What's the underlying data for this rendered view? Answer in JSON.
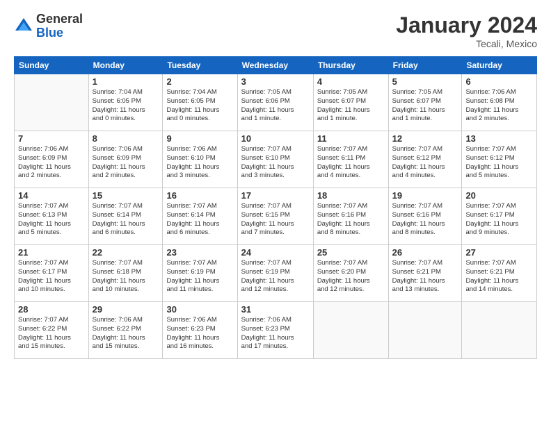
{
  "header": {
    "logo_general": "General",
    "logo_blue": "Blue",
    "month_title": "January 2024",
    "location": "Tecali, Mexico"
  },
  "days_of_week": [
    "Sunday",
    "Monday",
    "Tuesday",
    "Wednesday",
    "Thursday",
    "Friday",
    "Saturday"
  ],
  "weeks": [
    [
      {
        "day": "",
        "info": ""
      },
      {
        "day": "1",
        "info": "Sunrise: 7:04 AM\nSunset: 6:05 PM\nDaylight: 11 hours\nand 0 minutes."
      },
      {
        "day": "2",
        "info": "Sunrise: 7:04 AM\nSunset: 6:05 PM\nDaylight: 11 hours\nand 0 minutes."
      },
      {
        "day": "3",
        "info": "Sunrise: 7:05 AM\nSunset: 6:06 PM\nDaylight: 11 hours\nand 1 minute."
      },
      {
        "day": "4",
        "info": "Sunrise: 7:05 AM\nSunset: 6:07 PM\nDaylight: 11 hours\nand 1 minute."
      },
      {
        "day": "5",
        "info": "Sunrise: 7:05 AM\nSunset: 6:07 PM\nDaylight: 11 hours\nand 1 minute."
      },
      {
        "day": "6",
        "info": "Sunrise: 7:06 AM\nSunset: 6:08 PM\nDaylight: 11 hours\nand 2 minutes."
      }
    ],
    [
      {
        "day": "7",
        "info": "Sunrise: 7:06 AM\nSunset: 6:09 PM\nDaylight: 11 hours\nand 2 minutes."
      },
      {
        "day": "8",
        "info": "Sunrise: 7:06 AM\nSunset: 6:09 PM\nDaylight: 11 hours\nand 2 minutes."
      },
      {
        "day": "9",
        "info": "Sunrise: 7:06 AM\nSunset: 6:10 PM\nDaylight: 11 hours\nand 3 minutes."
      },
      {
        "day": "10",
        "info": "Sunrise: 7:07 AM\nSunset: 6:10 PM\nDaylight: 11 hours\nand 3 minutes."
      },
      {
        "day": "11",
        "info": "Sunrise: 7:07 AM\nSunset: 6:11 PM\nDaylight: 11 hours\nand 4 minutes."
      },
      {
        "day": "12",
        "info": "Sunrise: 7:07 AM\nSunset: 6:12 PM\nDaylight: 11 hours\nand 4 minutes."
      },
      {
        "day": "13",
        "info": "Sunrise: 7:07 AM\nSunset: 6:12 PM\nDaylight: 11 hours\nand 5 minutes."
      }
    ],
    [
      {
        "day": "14",
        "info": "Sunrise: 7:07 AM\nSunset: 6:13 PM\nDaylight: 11 hours\nand 5 minutes."
      },
      {
        "day": "15",
        "info": "Sunrise: 7:07 AM\nSunset: 6:14 PM\nDaylight: 11 hours\nand 6 minutes."
      },
      {
        "day": "16",
        "info": "Sunrise: 7:07 AM\nSunset: 6:14 PM\nDaylight: 11 hours\nand 6 minutes."
      },
      {
        "day": "17",
        "info": "Sunrise: 7:07 AM\nSunset: 6:15 PM\nDaylight: 11 hours\nand 7 minutes."
      },
      {
        "day": "18",
        "info": "Sunrise: 7:07 AM\nSunset: 6:16 PM\nDaylight: 11 hours\nand 8 minutes."
      },
      {
        "day": "19",
        "info": "Sunrise: 7:07 AM\nSunset: 6:16 PM\nDaylight: 11 hours\nand 8 minutes."
      },
      {
        "day": "20",
        "info": "Sunrise: 7:07 AM\nSunset: 6:17 PM\nDaylight: 11 hours\nand 9 minutes."
      }
    ],
    [
      {
        "day": "21",
        "info": "Sunrise: 7:07 AM\nSunset: 6:17 PM\nDaylight: 11 hours\nand 10 minutes."
      },
      {
        "day": "22",
        "info": "Sunrise: 7:07 AM\nSunset: 6:18 PM\nDaylight: 11 hours\nand 10 minutes."
      },
      {
        "day": "23",
        "info": "Sunrise: 7:07 AM\nSunset: 6:19 PM\nDaylight: 11 hours\nand 11 minutes."
      },
      {
        "day": "24",
        "info": "Sunrise: 7:07 AM\nSunset: 6:19 PM\nDaylight: 11 hours\nand 12 minutes."
      },
      {
        "day": "25",
        "info": "Sunrise: 7:07 AM\nSunset: 6:20 PM\nDaylight: 11 hours\nand 12 minutes."
      },
      {
        "day": "26",
        "info": "Sunrise: 7:07 AM\nSunset: 6:21 PM\nDaylight: 11 hours\nand 13 minutes."
      },
      {
        "day": "27",
        "info": "Sunrise: 7:07 AM\nSunset: 6:21 PM\nDaylight: 11 hours\nand 14 minutes."
      }
    ],
    [
      {
        "day": "28",
        "info": "Sunrise: 7:07 AM\nSunset: 6:22 PM\nDaylight: 11 hours\nand 15 minutes."
      },
      {
        "day": "29",
        "info": "Sunrise: 7:06 AM\nSunset: 6:22 PM\nDaylight: 11 hours\nand 15 minutes."
      },
      {
        "day": "30",
        "info": "Sunrise: 7:06 AM\nSunset: 6:23 PM\nDaylight: 11 hours\nand 16 minutes."
      },
      {
        "day": "31",
        "info": "Sunrise: 7:06 AM\nSunset: 6:23 PM\nDaylight: 11 hours\nand 17 minutes."
      },
      {
        "day": "",
        "info": ""
      },
      {
        "day": "",
        "info": ""
      },
      {
        "day": "",
        "info": ""
      }
    ]
  ]
}
